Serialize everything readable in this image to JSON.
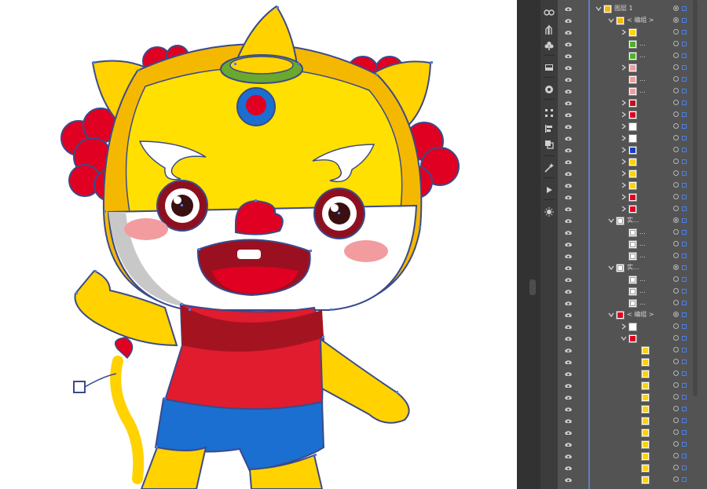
{
  "layers_panel": {
    "rows": [
      {
        "indent": 0,
        "twirl": "down",
        "thumb": "mascot",
        "label": "图层 1",
        "target": "double",
        "selected": true
      },
      {
        "indent": 1,
        "twirl": "down",
        "thumb": "mascot",
        "label": "< 编组 >",
        "target": "double",
        "selected": true
      },
      {
        "indent": 2,
        "twirl": "right",
        "thumb": "yellow",
        "label": "",
        "target": "single",
        "selected": true
      },
      {
        "indent": 2,
        "twirl": "",
        "thumb": "green",
        "label": "...",
        "target": "single",
        "selected": true
      },
      {
        "indent": 2,
        "twirl": "",
        "thumb": "green",
        "label": "...",
        "target": "single",
        "selected": true
      },
      {
        "indent": 2,
        "twirl": "right",
        "thumb": "pink",
        "label": "",
        "target": "single",
        "selected": true
      },
      {
        "indent": 2,
        "twirl": "",
        "thumb": "pink",
        "label": "...",
        "target": "single",
        "selected": true
      },
      {
        "indent": 2,
        "twirl": "",
        "thumb": "pink",
        "label": "...",
        "target": "single",
        "selected": true
      },
      {
        "indent": 2,
        "twirl": "right",
        "thumb": "red-mouth",
        "label": "",
        "target": "single",
        "selected": true
      },
      {
        "indent": 2,
        "twirl": "right",
        "thumb": "red",
        "label": "",
        "target": "single",
        "selected": true
      },
      {
        "indent": 2,
        "twirl": "right",
        "thumb": "white-brow",
        "label": "",
        "target": "single",
        "selected": true
      },
      {
        "indent": 2,
        "twirl": "right",
        "thumb": "white-brow",
        "label": "",
        "target": "single",
        "selected": true
      },
      {
        "indent": 2,
        "twirl": "right",
        "thumb": "blue-eye",
        "label": "",
        "target": "single",
        "selected": true
      },
      {
        "indent": 2,
        "twirl": "right",
        "thumb": "yellow",
        "label": "",
        "target": "single",
        "selected": true
      },
      {
        "indent": 2,
        "twirl": "right",
        "thumb": "yellow",
        "label": "",
        "target": "single",
        "selected": true
      },
      {
        "indent": 2,
        "twirl": "right",
        "thumb": "yellow",
        "label": "",
        "target": "single",
        "selected": true
      },
      {
        "indent": 2,
        "twirl": "right",
        "thumb": "red-stroke",
        "label": "",
        "target": "single",
        "selected": true
      },
      {
        "indent": 2,
        "twirl": "right",
        "thumb": "red-stroke",
        "label": "",
        "target": "single",
        "selected": true
      },
      {
        "indent": 1,
        "twirl": "down",
        "thumb": "sketch",
        "label": "实...",
        "target": "double",
        "selected": true
      },
      {
        "indent": 2,
        "twirl": "",
        "thumb": "sketch",
        "label": "...",
        "target": "single",
        "selected": true
      },
      {
        "indent": 2,
        "twirl": "",
        "thumb": "blank",
        "label": "...",
        "target": "single",
        "selected": true
      },
      {
        "indent": 2,
        "twirl": "",
        "thumb": "blank",
        "label": "...",
        "target": "single",
        "selected": true
      },
      {
        "indent": 1,
        "twirl": "down",
        "thumb": "sketch",
        "label": "实...",
        "target": "double",
        "selected": true
      },
      {
        "indent": 2,
        "twirl": "",
        "thumb": "blank",
        "label": "...",
        "target": "single",
        "selected": true
      },
      {
        "indent": 2,
        "twirl": "",
        "thumb": "sketch",
        "label": "...",
        "target": "single",
        "selected": true
      },
      {
        "indent": 2,
        "twirl": "",
        "thumb": "sketch",
        "label": "...",
        "target": "single",
        "selected": true
      },
      {
        "indent": 1,
        "twirl": "down",
        "thumb": "red-mini",
        "label": "< 编组 >",
        "target": "double",
        "selected": true
      },
      {
        "indent": 2,
        "twirl": "right",
        "thumb": "white-brow",
        "label": "",
        "target": "single",
        "selected": true
      },
      {
        "indent": 2,
        "twirl": "down",
        "thumb": "red-mini",
        "label": "",
        "target": "single",
        "selected": true
      },
      {
        "indent": 3,
        "twirl": "",
        "thumb": "yellow",
        "label": "",
        "target": "single",
        "selected": true
      },
      {
        "indent": 3,
        "twirl": "",
        "thumb": "yellow",
        "label": "",
        "target": "single",
        "selected": true
      },
      {
        "indent": 3,
        "twirl": "",
        "thumb": "yellow",
        "label": "",
        "target": "single",
        "selected": true
      },
      {
        "indent": 3,
        "twirl": "",
        "thumb": "yellow",
        "label": "",
        "target": "single",
        "selected": true
      },
      {
        "indent": 3,
        "twirl": "",
        "thumb": "yellow",
        "label": "",
        "target": "single",
        "selected": true
      },
      {
        "indent": 3,
        "twirl": "",
        "thumb": "yellow",
        "label": "",
        "target": "single",
        "selected": true
      },
      {
        "indent": 3,
        "twirl": "",
        "thumb": "yellow",
        "label": "",
        "target": "single",
        "selected": true
      },
      {
        "indent": 3,
        "twirl": "",
        "thumb": "yellow",
        "label": "",
        "target": "single",
        "selected": true
      },
      {
        "indent": 3,
        "twirl": "",
        "thumb": "yellow",
        "label": "",
        "target": "single",
        "selected": true
      },
      {
        "indent": 3,
        "twirl": "",
        "thumb": "yellow",
        "label": "",
        "target": "single",
        "selected": true
      },
      {
        "indent": 3,
        "twirl": "",
        "thumb": "yellow",
        "label": "",
        "target": "single",
        "selected": true
      },
      {
        "indent": 3,
        "twirl": "",
        "thumb": "yellow",
        "label": "",
        "target": "single",
        "selected": true
      }
    ]
  },
  "toolbar_icons": [
    "link-icon",
    "puppet-warp-icon",
    "club-icon",
    "artboard-icon",
    "color-guide-icon",
    "align-icon",
    "align-left-icon",
    "pathfinder-icon",
    "magic-wand-icon",
    "play-icon",
    "sun-icon"
  ],
  "colors": {
    "panel_bg": "#535353",
    "selection": "#4a7fe8",
    "mascot_yellow": "#ffe000",
    "mascot_orange": "#f5b800",
    "mascot_red": "#e00022",
    "shirt_red": "#e01c2e",
    "shorts_blue": "#1a6fd1",
    "cheek_pink": "#f39ca0"
  }
}
